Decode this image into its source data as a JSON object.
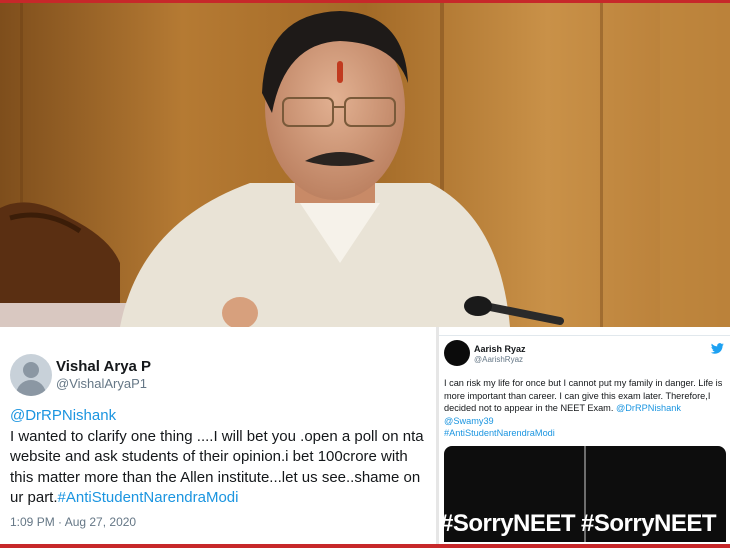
{
  "left_tweet": {
    "name": "Vishal Arya P",
    "handle": "@VishalAryaP1",
    "mention": "@DrRPNishank",
    "text": " I wanted to clarify one thing ....I will bet you .open a poll on nta website and ask students of their opinion.i bet 100crore with this matter more than the Allen institute...let us see..shame on ur part.",
    "hashtag": "#AntiStudentNarendraModi",
    "timestamp": "1:09 PM · Aug 27, 2020"
  },
  "right_tweet": {
    "name": "Aarish Ryaz",
    "handle": "@AarishRyaz",
    "text": "I can risk my life for once but I cannot put my family in danger. Life is more important than career. I can give this exam later. Therefore,I decided not to appear in the NEET Exam. ",
    "mention_1": "@DrRPNishank",
    "mention_2": "@Swamy39",
    "hashtag": "#AntiStudentNarendraModi",
    "media_tag_1": "#SorryNEET",
    "media_tag_2": "#SorryNEET"
  },
  "colors": {
    "frame": "#c7282a",
    "link": "#1b95e0",
    "text": "#14171a",
    "muted": "#657786",
    "twitter_bird": "#1da1f2"
  },
  "icons": {
    "twitter": "twitter-bird-icon",
    "default_avatar": "default-avatar-icon"
  }
}
